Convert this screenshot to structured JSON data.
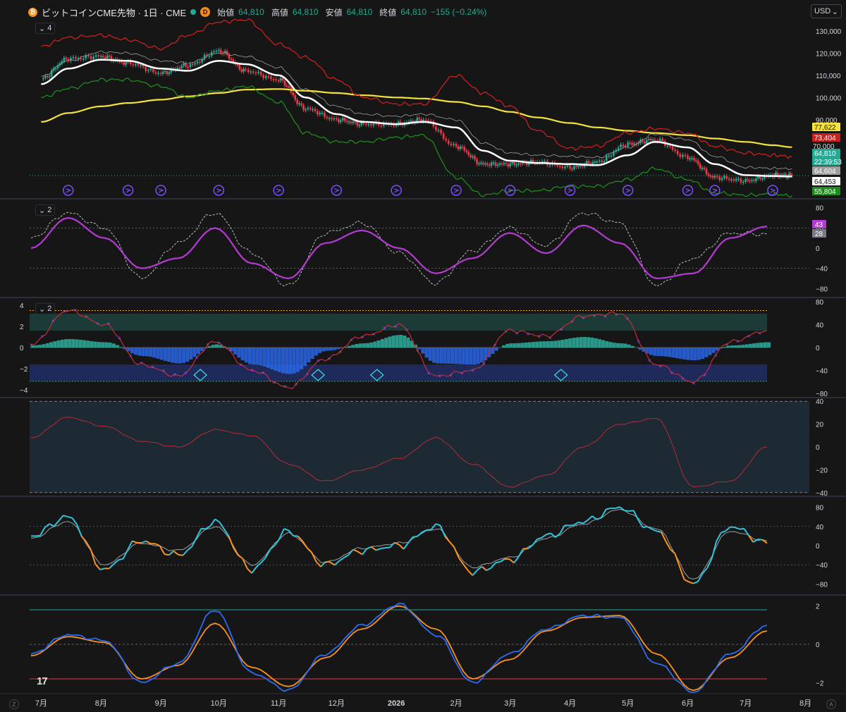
{
  "header": {
    "symbol_title": "ビットコインCME先物 · 1日 · CME",
    "interval_badge": "D",
    "ohlc": [
      {
        "key": "始値",
        "value": "64,810"
      },
      {
        "key": "高値",
        "value": "64,810"
      },
      {
        "key": "安値",
        "value": "64,810"
      },
      {
        "key": "終値",
        "value": "64,810"
      }
    ],
    "change": "−155 (−0.24%)",
    "currency": "USD",
    "currency_chevron": "chevron-down-icon"
  },
  "panes": [
    {
      "toggle_label": "4",
      "icon": "chevron-down-icon"
    },
    {
      "toggle_label": "2",
      "icon": "chevron-down-icon"
    },
    {
      "toggle_label": "2",
      "icon": "chevron-down-icon"
    }
  ],
  "x_axis": [
    "7月",
    "8月",
    "9月",
    "10月",
    "11月",
    "12月",
    "2026",
    "2月",
    "3月",
    "4月",
    "5月",
    "6月",
    "7月",
    "8月"
  ],
  "corner_buttons": [
    "Z",
    "A"
  ],
  "logo_text": "17",
  "colors": {
    "up": "#22ab94",
    "down": "#f23645",
    "white_ma": "#ffffff",
    "yellow_ma": "#f5e23d",
    "upper_band": "#c8201e",
    "lower_band": "#1d8a1d",
    "purple": "#b43bd2",
    "cyan": "#2ec5dc",
    "orange": "#f7931e",
    "blue": "#2d6cf0",
    "teal_line": "#1fa89a"
  },
  "chart_data": [
    {
      "type": "line",
      "title": "ビットコインCME先物 · 1日 · CME",
      "ylim": [
        55000,
        135000
      ],
      "y_ticks": [
        90000,
        100000,
        110000,
        120000,
        130000
      ],
      "y_tick_labels": [
        "90,000",
        "100,000",
        "110,000",
        "120,000",
        "130,000"
      ],
      "price_labels": [
        {
          "value": "77,622",
          "color": "#f5e23d"
        },
        {
          "value": "73,404",
          "color": "#c8201e"
        },
        {
          "value": "70,000",
          "color": "#d1d4dc"
        },
        {
          "value": "64,810",
          "color": "#22ab94"
        },
        {
          "value": "22:39:53",
          "color": "#22ab94"
        },
        {
          "value": "64,604",
          "color": "#9e9e9e"
        },
        {
          "value": "64,453",
          "color": "#ffffff"
        },
        {
          "value": "55,804",
          "color": "#1d8a1d"
        }
      ],
      "x": [
        "2025-07-01",
        "2025-07-15",
        "2025-08-01",
        "2025-08-15",
        "2025-09-01",
        "2025-09-15",
        "2025-10-01",
        "2025-10-15",
        "2025-11-01",
        "2025-11-15",
        "2025-12-01",
        "2025-12-15",
        "2026-01-01",
        "2026-01-15",
        "2026-02-01",
        "2026-02-15",
        "2026-03-01",
        "2026-03-15",
        "2026-04-01",
        "2026-04-15",
        "2026-05-01",
        "2026-05-15",
        "2026-06-01",
        "2026-06-15",
        "2026-07-01",
        "2026-07-15",
        "2026-07-25"
      ],
      "series": [
        {
          "values": [
            108500,
            117500,
            118500,
            115500,
            111000,
            114500,
            121000,
            112000,
            108000,
            95000,
            90000,
            88000,
            88000,
            90000,
            78000,
            70000,
            70000,
            71000,
            68500,
            71000,
            79000,
            81000,
            73000,
            64000,
            62500,
            65000,
            64810
          ]
        },
        {
          "values": [
            106000,
            113000,
            117000,
            116500,
            113000,
            112000,
            116500,
            115000,
            110000,
            100000,
            92500,
            89000,
            88000,
            89000,
            86500,
            76000,
            71500,
            70500,
            70000,
            69500,
            74000,
            80000,
            77500,
            70000,
            65000,
            64600,
            64453
          ]
        },
        {
          "values": [
            89000,
            93000,
            96000,
            97500,
            99000,
            100500,
            102000,
            103500,
            103800,
            103000,
            102000,
            101000,
            100000,
            99500,
            98000,
            96000,
            93500,
            91000,
            88500,
            86500,
            85000,
            84000,
            83000,
            81500,
            80000,
            78500,
            77622
          ]
        },
        {
          "values": [
            123000,
            127000,
            128000,
            126000,
            122000,
            128000,
            134000,
            135000,
            124000,
            118000,
            108000,
            100000,
            97000,
            97000,
            110000,
            102000,
            96000,
            85000,
            77000,
            78000,
            84000,
            86000,
            84000,
            78000,
            75000,
            74000,
            73404
          ]
        },
        {
          "values": [
            100000,
            104000,
            108000,
            108000,
            105000,
            100000,
            103000,
            105000,
            98000,
            84000,
            80000,
            80000,
            82000,
            83000,
            64000,
            56000,
            58000,
            58000,
            60000,
            60000,
            63000,
            68000,
            63000,
            57000,
            56000,
            56500,
            55804
          ]
        }
      ],
      "vertical_markers": [
        "2025-07-15",
        "2025-08-15",
        "2025-09-01",
        "2025-10-01",
        "2025-11-01",
        "2025-12-01",
        "2026-01-01",
        "2026-02-01",
        "2026-03-01",
        "2026-04-01",
        "2026-05-01",
        "2026-06-01",
        "2026-06-15",
        "2026-07-15"
      ]
    },
    {
      "type": "line",
      "ylim": [
        -95,
        95
      ],
      "y_ticks": [
        -80,
        -40,
        0,
        40,
        80
      ],
      "y_tick_labels": [
        "−80",
        "−40",
        "0",
        "40",
        "80"
      ],
      "price_labels": [
        {
          "value": "43",
          "color": "#b43bd2"
        },
        {
          "value": "28",
          "color": "#787b86"
        }
      ],
      "x": [
        0,
        0.05,
        0.1,
        0.15,
        0.2,
        0.25,
        0.3,
        0.35,
        0.4,
        0.45,
        0.5,
        0.55,
        0.6,
        0.65,
        0.7,
        0.75,
        0.8,
        0.85,
        0.9,
        0.95,
        1
      ],
      "series": [
        {
          "values": [
            0,
            60,
            20,
            -40,
            -20,
            40,
            -30,
            -60,
            10,
            35,
            0,
            -50,
            -20,
            30,
            -10,
            45,
            10,
            -60,
            -50,
            20,
            43
          ]
        },
        {
          "values": [
            20,
            70,
            40,
            -60,
            10,
            70,
            -10,
            -75,
            30,
            50,
            -10,
            -70,
            -5,
            40,
            5,
            70,
            50,
            -75,
            -20,
            30,
            28
          ]
        }
      ]
    },
    {
      "type": "area",
      "ylim_left": [
        -4.6,
        4.6
      ],
      "y_ticks_left": [
        -4,
        -2,
        0,
        2,
        4
      ],
      "y_tick_labels_left": [
        "−4",
        "−2",
        "0",
        "2",
        "4"
      ],
      "ylim_right": [
        -85,
        85
      ],
      "y_ticks_right": [
        -80,
        -40,
        0,
        40,
        80
      ],
      "y_tick_labels_right": [
        "−80",
        "−40",
        "0",
        "40",
        "80"
      ],
      "x": [
        0,
        0.05,
        0.1,
        0.15,
        0.2,
        0.25,
        0.3,
        0.35,
        0.4,
        0.45,
        0.5,
        0.55,
        0.6,
        0.65,
        0.7,
        0.75,
        0.8,
        0.85,
        0.9,
        0.95,
        1
      ],
      "series": [
        {
          "values": [
            0.2,
            0.8,
            0.5,
            -0.8,
            -1.5,
            0.3,
            -1.6,
            -2.5,
            -0.3,
            0.4,
            1.2,
            -1.5,
            -1.6,
            0.4,
            0.6,
            1.0,
            0.4,
            -0.8,
            -1.2,
            0.2,
            0.5
          ]
        },
        {
          "values": [
            5,
            65,
            40,
            -30,
            -50,
            10,
            -40,
            -70,
            -20,
            20,
            40,
            -50,
            -40,
            30,
            20,
            55,
            60,
            -30,
            -60,
            10,
            30
          ]
        }
      ],
      "signals": [
        0.23,
        0.39,
        0.47,
        0.72
      ]
    },
    {
      "type": "line",
      "ylim": [
        -42,
        42
      ],
      "y_ticks": [
        -40,
        -20,
        0,
        20,
        40
      ],
      "y_tick_labels": [
        "−40",
        "−20",
        "0",
        "20",
        "40"
      ],
      "x": [
        0,
        0.05,
        0.1,
        0.15,
        0.2,
        0.25,
        0.3,
        0.35,
        0.4,
        0.45,
        0.5,
        0.55,
        0.6,
        0.65,
        0.7,
        0.75,
        0.8,
        0.85,
        0.9,
        0.95,
        1
      ],
      "series": [
        {
          "values": [
            8,
            26,
            18,
            5,
            0,
            15,
            10,
            -15,
            -30,
            -20,
            -10,
            8,
            -15,
            -35,
            -25,
            0,
            20,
            25,
            -35,
            -30,
            0
          ]
        }
      ]
    },
    {
      "type": "line",
      "ylim": [
        -100,
        100
      ],
      "y_ticks": [
        -80,
        -40,
        0,
        40,
        80
      ],
      "y_tick_labels": [
        "−80",
        "−40",
        "0",
        "40",
        "80"
      ],
      "x": [
        0,
        0.05,
        0.1,
        0.15,
        0.2,
        0.25,
        0.3,
        0.35,
        0.4,
        0.45,
        0.5,
        0.55,
        0.6,
        0.65,
        0.7,
        0.75,
        0.8,
        0.85,
        0.9,
        0.95,
        1
      ],
      "series": [
        {
          "values": [
            20,
            60,
            -50,
            10,
            -20,
            50,
            -50,
            30,
            -40,
            -10,
            0,
            40,
            -55,
            -30,
            20,
            50,
            80,
            30,
            -80,
            40,
            5
          ]
        },
        {
          "values": [
            15,
            50,
            -40,
            5,
            -10,
            40,
            -40,
            25,
            -35,
            -5,
            5,
            35,
            -45,
            -25,
            15,
            45,
            75,
            35,
            -70,
            30,
            10
          ]
        }
      ]
    },
    {
      "type": "line",
      "ylim": [
        -2.5,
        2.5
      ],
      "y_ticks": [
        -2,
        0,
        2
      ],
      "y_tick_labels": [
        "−2",
        "0",
        "2"
      ],
      "x": [
        0,
        0.05,
        0.1,
        0.15,
        0.2,
        0.25,
        0.3,
        0.35,
        0.4,
        0.45,
        0.5,
        0.55,
        0.6,
        0.65,
        0.7,
        0.75,
        0.8,
        0.85,
        0.9,
        0.95,
        1
      ],
      "series": [
        {
          "values": [
            -0.5,
            0.5,
            0.2,
            -2.0,
            -1.0,
            1.8,
            -1.5,
            -2.4,
            -0.5,
            1.0,
            2.1,
            0.5,
            -2.0,
            -0.5,
            0.8,
            1.5,
            1.4,
            -1.0,
            -2.5,
            -0.5,
            1.0
          ]
        },
        {
          "values": [
            -0.6,
            0.4,
            0.1,
            -1.8,
            -1.1,
            1.1,
            -1.2,
            -2.2,
            -0.7,
            0.8,
            2.0,
            0.8,
            -1.8,
            -0.8,
            0.7,
            1.4,
            1.5,
            -0.5,
            -2.4,
            -0.7,
            0.7
          ]
        }
      ],
      "hlines": [
        1.8,
        -1.8
      ]
    }
  ]
}
